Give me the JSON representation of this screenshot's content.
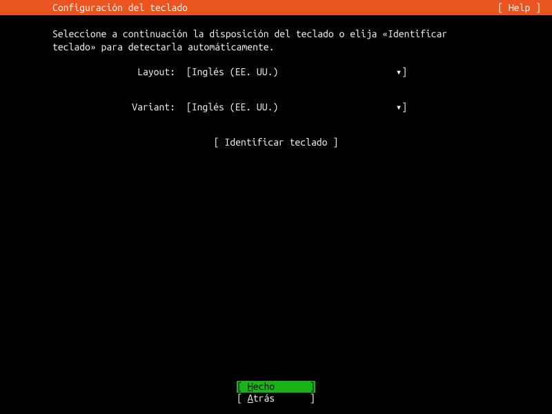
{
  "header": {
    "title": "Configuración del teclado",
    "help": "[ Help ]"
  },
  "instruction": {
    "line1": "Seleccione a continuación la disposición del teclado o elija «Identificar",
    "line2": "teclado» para detectarla automáticamente."
  },
  "form": {
    "layout": {
      "label": "Layout:",
      "open": "[ ",
      "value": "Inglés (EE. UU.)",
      "arrow": "▾",
      "close": " ]"
    },
    "variant": {
      "label": "Variant:",
      "open": "[ ",
      "value": "Inglés (EE. UU.)",
      "arrow": "▾",
      "close": " ]"
    }
  },
  "identify": {
    "open": "[ ",
    "label": "Identificar teclado",
    "close": " ]"
  },
  "footer": {
    "done": {
      "open": "[ ",
      "label_prefix": "H",
      "label_rest": "echo",
      "close": "]"
    },
    "back": {
      "open": "[ ",
      "label_prefix": "A",
      "label_rest": "trás",
      "close": "]"
    }
  }
}
